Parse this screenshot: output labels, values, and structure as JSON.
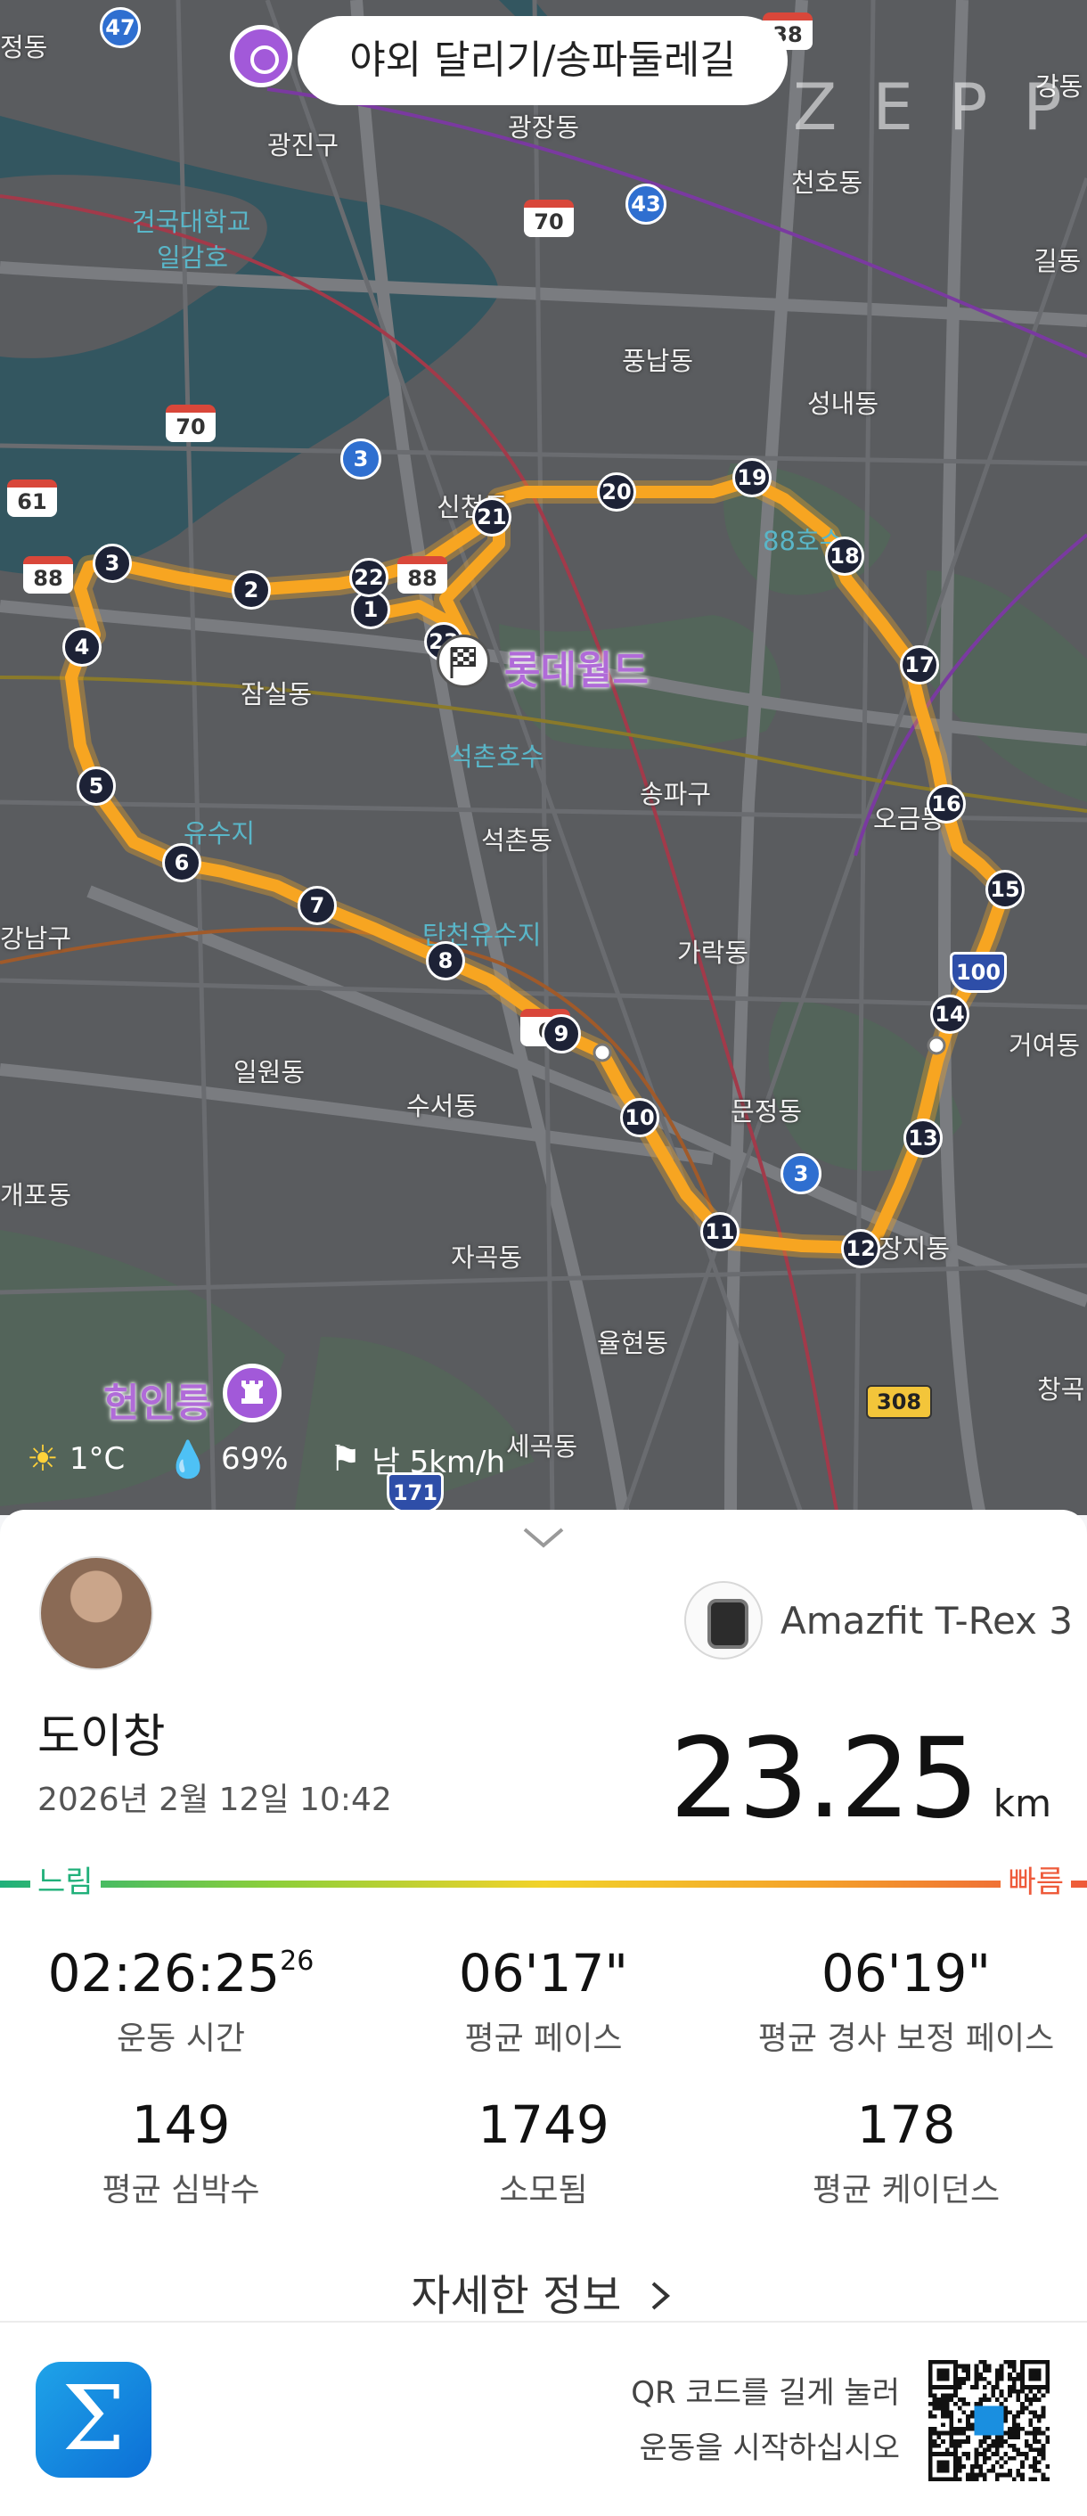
{
  "map": {
    "route_title": "야외 달리기/송파둘레길",
    "brand_watermark": "ZEPP",
    "poi_lotte": "롯데월드",
    "poi_heonin": "헌인릉",
    "labels": {
      "jeong": "정동",
      "gwangjin": "광진구",
      "gwangjang": "광장동",
      "cheonho": "천호동",
      "gildong": "길동",
      "gangdong": "강동",
      "konkuk": "건국대학교",
      "ilgamho": "일감호",
      "pungnap": "풍납동",
      "seongnae": "성내동",
      "sincheon": "신천동",
      "jamsil": "잠실동",
      "songpagu": "송파구",
      "seokchon": "석촌동",
      "ogeum": "오금동",
      "garak": "가락동",
      "ilwon": "일원동",
      "suseo": "수서동",
      "munjeong": "문정동",
      "geoyeo": "거여동",
      "jagok": "자곡동",
      "yulhyeon": "율현동",
      "segok": "세곡동",
      "jangji": "장지동",
      "changgok": "창곡",
      "gangnam": "강남구",
      "gaepo": "개포동",
      "seokchonho": "석촌호수",
      "yusuji": "유수지",
      "tanjeon": "탄천유수지",
      "pond88": "88호수"
    },
    "roads": {
      "r47": "47",
      "r38": "38",
      "r70a": "70",
      "r43": "43",
      "r70b": "70",
      "r61": "61",
      "r3a": "3",
      "r88a": "88",
      "r88b": "88",
      "r100": "100",
      "r3b": "3",
      "r308": "308",
      "r171": "171",
      "r6": "6"
    },
    "km_markers": [
      "1",
      "2",
      "3",
      "4",
      "5",
      "6",
      "7",
      "8",
      "9",
      "10",
      "11",
      "12",
      "13",
      "14",
      "15",
      "16",
      "17",
      "18",
      "19",
      "20",
      "21",
      "22",
      "23"
    ]
  },
  "weather": {
    "temperature": "1°C",
    "humidity": "69%",
    "wind": "남 5km/h",
    "sun_icon": "sun-icon",
    "humidity_icon": "droplet-icon",
    "wind_icon": "flag-icon"
  },
  "summary": {
    "device_name": "Amazfit T-Rex 3",
    "user_name": "도이창",
    "datetime": "2026년 2월 12일 10:42",
    "distance_value": "23.25",
    "distance_unit": "km",
    "pace_slow_label": "느림",
    "pace_fast_label": "빠름",
    "stats": {
      "duration_main": "02:26:25",
      "duration_fraction": "26",
      "duration_label": "운동 시간",
      "avg_pace": "06'17\"",
      "avg_pace_label": "평균 페이스",
      "grade_pace": "06'19\"",
      "grade_pace_label": "평균 경사 보정 페이스",
      "heart_rate": "149",
      "heart_rate_label": "평균 심박수",
      "calories": "1749",
      "calories_label": "소모됨",
      "cadence": "178",
      "cadence_label": "평균 케이던스"
    },
    "details_link": "자세한 정보"
  },
  "footer": {
    "app_icon": "zepp-sigma-logo",
    "app_logo_glyph": "Σ",
    "qr_hint_line1": "QR 코드를 길게 눌러",
    "qr_hint_line2": "운동을 시작하십시오"
  },
  "colors": {
    "route": "#f7a521",
    "marker": "#1d2236",
    "accent_purple": "#a259d9",
    "pace_slow": "#20b07a",
    "pace_fast": "#ee5a3a"
  }
}
